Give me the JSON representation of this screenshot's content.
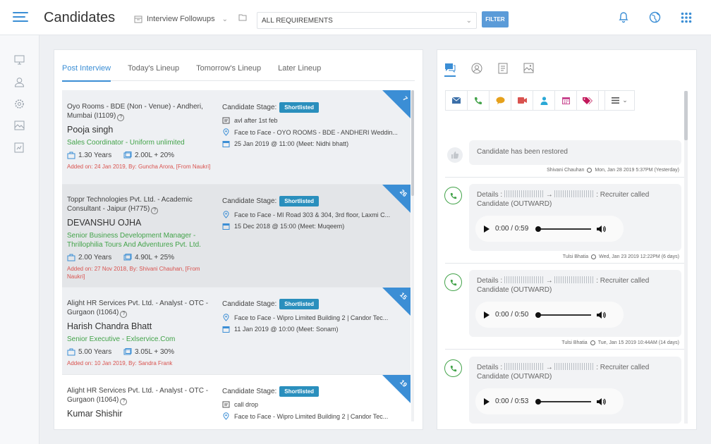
{
  "header": {
    "title": "Candidates",
    "followups_label": "Interview Followups",
    "requirements_value": "ALL REQUIREMENTS",
    "filter_label": "FILTER"
  },
  "left_tabs": [
    {
      "label": "Post Interview",
      "active": true
    },
    {
      "label": "Today's Lineup",
      "active": false
    },
    {
      "label": "Tomorrow's Lineup",
      "active": false
    },
    {
      "label": "Later Lineup",
      "active": false
    }
  ],
  "candidates": [
    {
      "job": "Oyo Rooms - BDE (Non - Venue) - Andheri, Mumbai (I1109)",
      "name": "Pooja singh",
      "title": "Sales Coordinator - Uniform unlimited",
      "experience": "1.30 Years",
      "salary": "2.00L + 20%",
      "added": "Added on: 24 Jan 2019, By: Guncha Arora, [From Naukri]",
      "stage_label": "Candidate Stage:",
      "stage": "Shortlisted",
      "note": "avl after 1st feb",
      "location": "Face to Face - OYO ROOMS - BDE - ANDHERI Weddin...",
      "schedule": "25 Jan 2019 @ 11:00 (Meet: Nidhi bhatt)",
      "badge": "7"
    },
    {
      "job": "Toppr Technologies Pvt. Ltd. - Academic Consultant - Jaipur (H775)",
      "name": "DEVANSHU OJHA",
      "title": "Senior Business Development Manager - Thrillophilia Tours And Adventures Pvt. Ltd.",
      "experience": "2.00 Years",
      "salary": "4.90L + 25%",
      "added": "Added on: 27 Nov 2018, By: Shivani Chauhan, [From Naukri]",
      "stage_label": "Candidate Stage:",
      "stage": "Shortlisted",
      "location": "Face to Face - MI Road 303 & 304, 3rd floor, Laxmi C...",
      "schedule": "15 Dec 2018 @ 15:00 (Meet: Muqeem)",
      "badge": "26"
    },
    {
      "job": "Alight HR Services Pvt. Ltd. - Analyst - OTC - Gurgaon (I1064)",
      "name": "Harish Chandra Bhatt",
      "title": "Senior Executive - Exlservice.Com",
      "experience": "5.00 Years",
      "salary": "3.05L + 30%",
      "added": "Added on: 10 Jan 2019, By: Sandra Frank",
      "stage_label": "Candidate Stage:",
      "stage": "Shortlisted",
      "location": "Face to Face - Wipro Limited Building 2 | Candor Tec...",
      "schedule": "11 Jan 2019 @ 10:00 (Meet: Sonam)",
      "badge": "15"
    },
    {
      "job": "Alight HR Services Pvt. Ltd. - Analyst - OTC - Gurgaon (I1064)",
      "name": "Kumar Shishir",
      "stage_label": "Candidate Stage:",
      "stage": "Shortlisted",
      "note": "call drop",
      "location": "Face to Face - Wipro Limited Building 2 | Candor Tec...",
      "badge": "19"
    }
  ],
  "activity": {
    "restored": {
      "text": "Candidate has been restored",
      "by": "Shivani Chauhan",
      "time": "Mon, Jan 28 2019 5:37PM (Yesterday)"
    },
    "calls": [
      {
        "prefix": "Details :",
        "suffix": ": Recruiter called",
        "line2": "Candidate (OUTWARD)",
        "time_display": "0:00 / 0:59",
        "by": "Tulsi Bhatia",
        "time": "Wed, Jan 23 2019 12:22PM (6 days)"
      },
      {
        "prefix": "Details :",
        "suffix": ": Recruiter called",
        "line2": "Candidate (OUTWARD)",
        "time_display": "0:00 / 0:50",
        "by": "Tulsi Bhatia",
        "time": "Tue, Jan 15 2019 10:44AM (14 days)"
      },
      {
        "prefix": "Details :",
        "suffix": ": Recruiter called",
        "line2": "Candidate (OUTWARD)",
        "time_display": "0:00 / 0:53"
      }
    ]
  },
  "colors": {
    "accent": "#3b8ed5",
    "green": "#43a34a",
    "red": "#d9534f",
    "badge": "#2a8fbd"
  }
}
